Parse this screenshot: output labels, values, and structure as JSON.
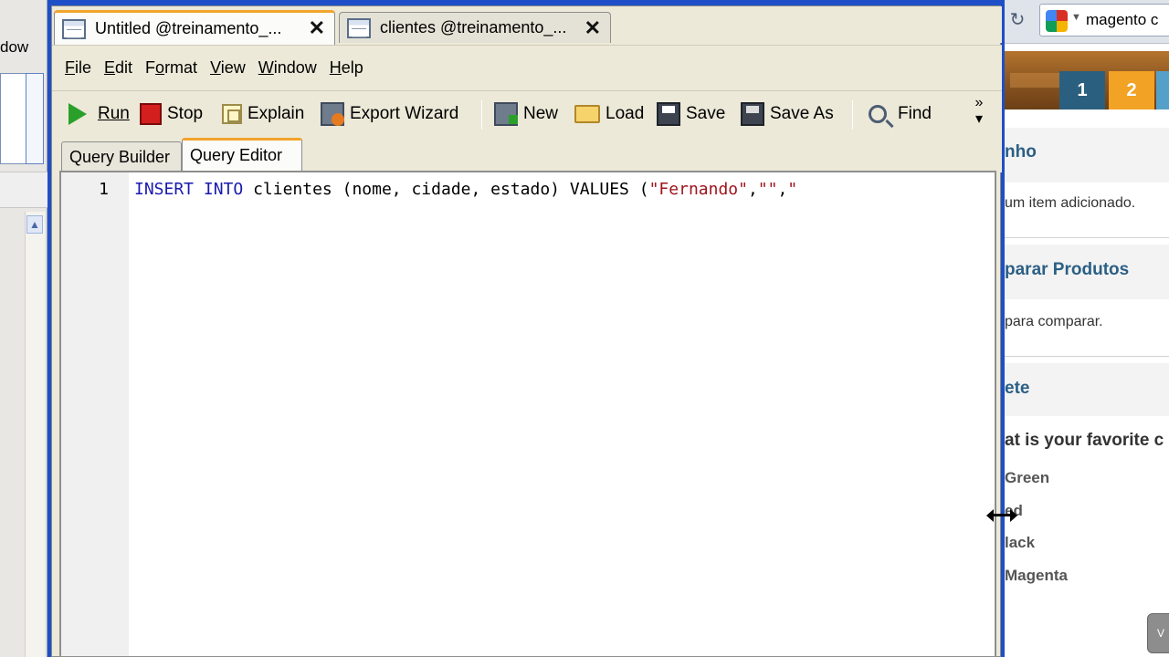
{
  "background_left": {
    "menu_fragment": "dow"
  },
  "background_right": {
    "search_text": "magento c",
    "badges": [
      "1",
      "2",
      ""
    ],
    "sections": [
      {
        "title": "nho",
        "text": "um item adicionado."
      },
      {
        "title": "parar Produtos",
        "text": "para comparar."
      },
      {
        "title": "ete",
        "text": ""
      }
    ],
    "poll_question": "at is your favorite c",
    "poll_options": [
      "Green",
      "ed",
      "lack",
      "Magenta"
    ],
    "vote_label": "V"
  },
  "window": {
    "tabs": [
      {
        "label": "Untitled @treinamento_...",
        "active": true
      },
      {
        "label": "clientes @treinamento_...",
        "active": false
      }
    ],
    "menu": [
      {
        "label": "File",
        "mnemonic": "F",
        "rest": "ile"
      },
      {
        "label": "Edit",
        "mnemonic": "E",
        "rest": "dit"
      },
      {
        "label": "Format",
        "mnemonic": "o",
        "prefix": "F",
        "rest": "rmat"
      },
      {
        "label": "View",
        "mnemonic": "V",
        "rest": "iew"
      },
      {
        "label": "Window",
        "mnemonic": "W",
        "rest": "indow"
      },
      {
        "label": "Help",
        "mnemonic": "H",
        "rest": "elp"
      }
    ],
    "toolbar": {
      "run": "Run",
      "stop": "Stop",
      "explain": "Explain",
      "export_wizard": "Export Wizard",
      "new": "New",
      "load": "Load",
      "save": "Save",
      "save_as": "Save As",
      "find": "Find",
      "more": "»"
    },
    "sub_tabs": [
      {
        "label": "Query Builder",
        "active": false
      },
      {
        "label": "Query Editor",
        "active": true
      }
    ],
    "editor": {
      "line_number": "1",
      "tokens": {
        "kw1": "INSERT",
        "kw2": "INTO",
        "table_part": "clientes (nome, cidade, estado)",
        "kw3": "VALUES",
        "paren": "(",
        "str1": "\"Fernando\"",
        "comma1": ",",
        "str2": "\"\"",
        "comma2": ",",
        "str3": "\""
      }
    }
  },
  "colors": {
    "window_frame": "#1f4fc7",
    "active_tab_accent": "#f2a42c",
    "sql_keyword": "#1a1ab0",
    "sql_string": "#a0141e"
  }
}
